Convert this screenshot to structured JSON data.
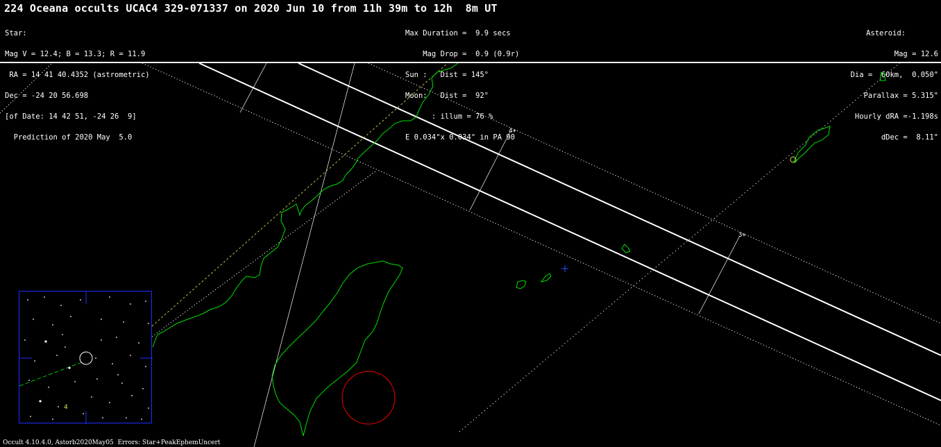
{
  "title": "224 Oceana occults UCAC4 329-071337 on 2020 Jun 10 from 11h 39m to 12h  8m UT",
  "star": {
    "lines": [
      "Star:",
      "Mag V = 12.4; B = 13.3; R = 11.9",
      " RA = 14 41 40.4352 (astrometric)",
      "Dec = -24 20 56.698",
      "[of Date: 14 42 51, -24 26  9]",
      "  Prediction of 2020 May  5.0"
    ]
  },
  "circumstances": {
    "lines": [
      "Max Duration =  9.9 secs",
      "    Mag Drop =  0.9 (0.9r)",
      "Sun :   Dist = 145°",
      "Moon:   Dist =  92°",
      "      : illum = 76 %",
      "E 0.034\"x 0.034\" in PA 90"
    ]
  },
  "asteroid": {
    "title": "Asteroid:",
    "lines": [
      "Mag = 12.6",
      "Dia =  60km,  0.050\"",
      "Parallax = 5.315\"",
      "Hourly dRA =-1.198s",
      "dDec =  8.11\""
    ]
  },
  "map": {
    "time_labels": [
      "4+",
      "3+"
    ],
    "inset_label": "4"
  },
  "colors": {
    "path": "#ffffff",
    "coast": "#00e000",
    "twilight": "#b9c44a",
    "site": "#ff0000",
    "inset_border": "#1f2fff",
    "center_cross": "#3050ff"
  },
  "footer": "Occult 4.10.4.0, Astorb2020May05  Errors: Star+PeakEphemUncert"
}
